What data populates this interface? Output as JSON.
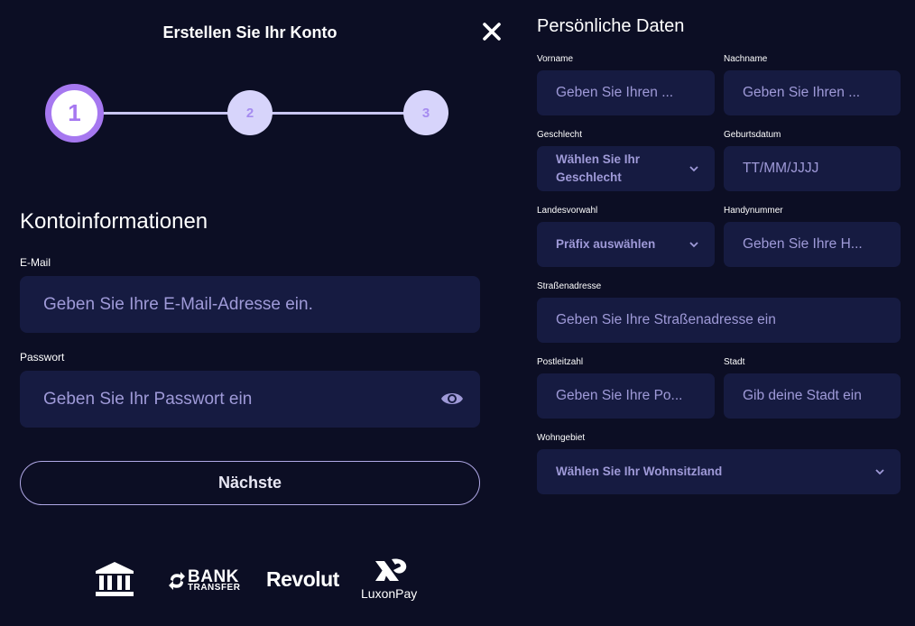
{
  "header": {
    "title": "Erstellen Sie Ihr Konto"
  },
  "stepper": {
    "steps": [
      "1",
      "2",
      "3"
    ],
    "current": 1
  },
  "account": {
    "section_title": "Kontoinformationen",
    "email_label": "E-Mail",
    "email_placeholder": "Geben Sie Ihre E-Mail-Adresse ein.",
    "password_label": "Passwort",
    "password_placeholder": "Geben Sie Ihr Passwort ein",
    "next_label": "Nächste"
  },
  "payments": {
    "bank_transfer_big": "BANK",
    "bank_transfer_small": "TRANSFER",
    "revolut": "Revolut",
    "luxon": "LuxonPay"
  },
  "personal": {
    "title": "Persönliche Daten",
    "first_name_label": "Vorname",
    "first_name_placeholder": "Geben Sie Ihren ...",
    "last_name_label": "Nachname",
    "last_name_placeholder": "Geben Sie Ihren ...",
    "gender_label": "Geschlecht",
    "gender_placeholder": "Wählen Sie Ihr Geschlecht",
    "dob_label": "Geburtsdatum",
    "dob_placeholder": "TT/MM/JJJJ",
    "dial_label": "Landesvorwahl",
    "dial_placeholder": "Präfix auswählen",
    "mobile_label": "Handynummer",
    "mobile_placeholder": "Geben Sie Ihre H...",
    "street_label": "Straßenadresse",
    "street_placeholder": "Geben Sie Ihre Straßenadresse ein",
    "zip_label": "Postleitzahl",
    "zip_placeholder": "Geben Sie Ihre Po...",
    "city_label": "Stadt",
    "city_placeholder": "Gib deine Stadt ein",
    "residence_label": "Wohngebiet",
    "residence_placeholder": "Wählen Sie Ihr Wohnsitzland"
  },
  "colors": {
    "background": "#0c0e24",
    "field": "#161b41",
    "placeholder": "#9f9ad8",
    "accent": "#a678f0",
    "step_inactive": "#d7d4fb"
  },
  "icons": [
    "close-icon",
    "eye-icon",
    "chevron-down-icon",
    "bank-icon",
    "luxon-logo-icon"
  ]
}
